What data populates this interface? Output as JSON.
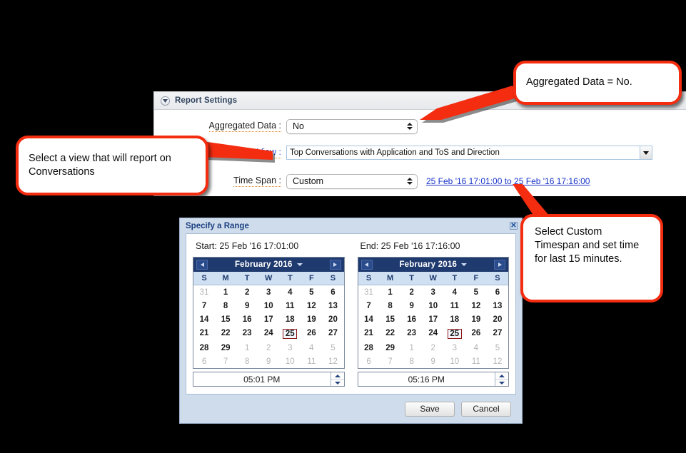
{
  "panel": {
    "header_title": "Report Settings",
    "collapse_icon": "triangle-down-icon",
    "fields": {
      "aggregated_data": {
        "label": "Aggregated Data :",
        "value": "No"
      },
      "view": {
        "label": "View :",
        "value": "Top Conversations with Application and ToS and Direction"
      },
      "time_span": {
        "label": "Time Span :",
        "value": "Custom"
      }
    },
    "timespan_link": "25 Feb '16 17:01:00 to 25 Feb '16 17:16:00"
  },
  "dialog": {
    "title": "Specify a Range",
    "close_label": "✕",
    "start": {
      "caption": "Start:  25 Feb '16 17:01:00",
      "month_title": "February 2016",
      "time": "05:01 PM",
      "selected_day": "25"
    },
    "end": {
      "caption": "End:  25 Feb '16 17:16:00",
      "month_title": "February 2016",
      "time": "05:16 PM",
      "selected_day": "25"
    },
    "dow": [
      "S",
      "M",
      "T",
      "W",
      "T",
      "F",
      "S"
    ],
    "weeks": [
      [
        {
          "d": "31",
          "out": true
        },
        {
          "d": "1"
        },
        {
          "d": "2"
        },
        {
          "d": "3"
        },
        {
          "d": "4"
        },
        {
          "d": "5"
        },
        {
          "d": "6"
        }
      ],
      [
        {
          "d": "7"
        },
        {
          "d": "8"
        },
        {
          "d": "9"
        },
        {
          "d": "10"
        },
        {
          "d": "11"
        },
        {
          "d": "12"
        },
        {
          "d": "13"
        }
      ],
      [
        {
          "d": "14"
        },
        {
          "d": "15"
        },
        {
          "d": "16"
        },
        {
          "d": "17"
        },
        {
          "d": "18"
        },
        {
          "d": "19"
        },
        {
          "d": "20"
        }
      ],
      [
        {
          "d": "21"
        },
        {
          "d": "22"
        },
        {
          "d": "23"
        },
        {
          "d": "24"
        },
        {
          "d": "25",
          "sel": true
        },
        {
          "d": "26"
        },
        {
          "d": "27"
        }
      ],
      [
        {
          "d": "28"
        },
        {
          "d": "29"
        },
        {
          "d": "1",
          "out": true
        },
        {
          "d": "2",
          "out": true
        },
        {
          "d": "3",
          "out": true
        },
        {
          "d": "4",
          "out": true
        },
        {
          "d": "5",
          "out": true
        }
      ],
      [
        {
          "d": "6",
          "out": true
        },
        {
          "d": "7",
          "out": true
        },
        {
          "d": "8",
          "out": true
        },
        {
          "d": "9",
          "out": true
        },
        {
          "d": "10",
          "out": true
        },
        {
          "d": "11",
          "out": true
        },
        {
          "d": "12",
          "out": true
        }
      ]
    ],
    "buttons": {
      "save": "Save",
      "cancel": "Cancel"
    }
  },
  "callouts": {
    "aggregated": "Aggregated Data = No.",
    "view": "Select a view that will report on Conversations",
    "custom": "Select Custom Timespan and set time for last 15 minutes."
  },
  "colors": {
    "callout_border": "#f42c10",
    "calendar_header": "#1f3a6e",
    "dialog_chrome": "#cfdceb",
    "link": "#1a34c8",
    "label_underline": "#e08a2e",
    "selected_day_border": "#8b1a1a"
  }
}
